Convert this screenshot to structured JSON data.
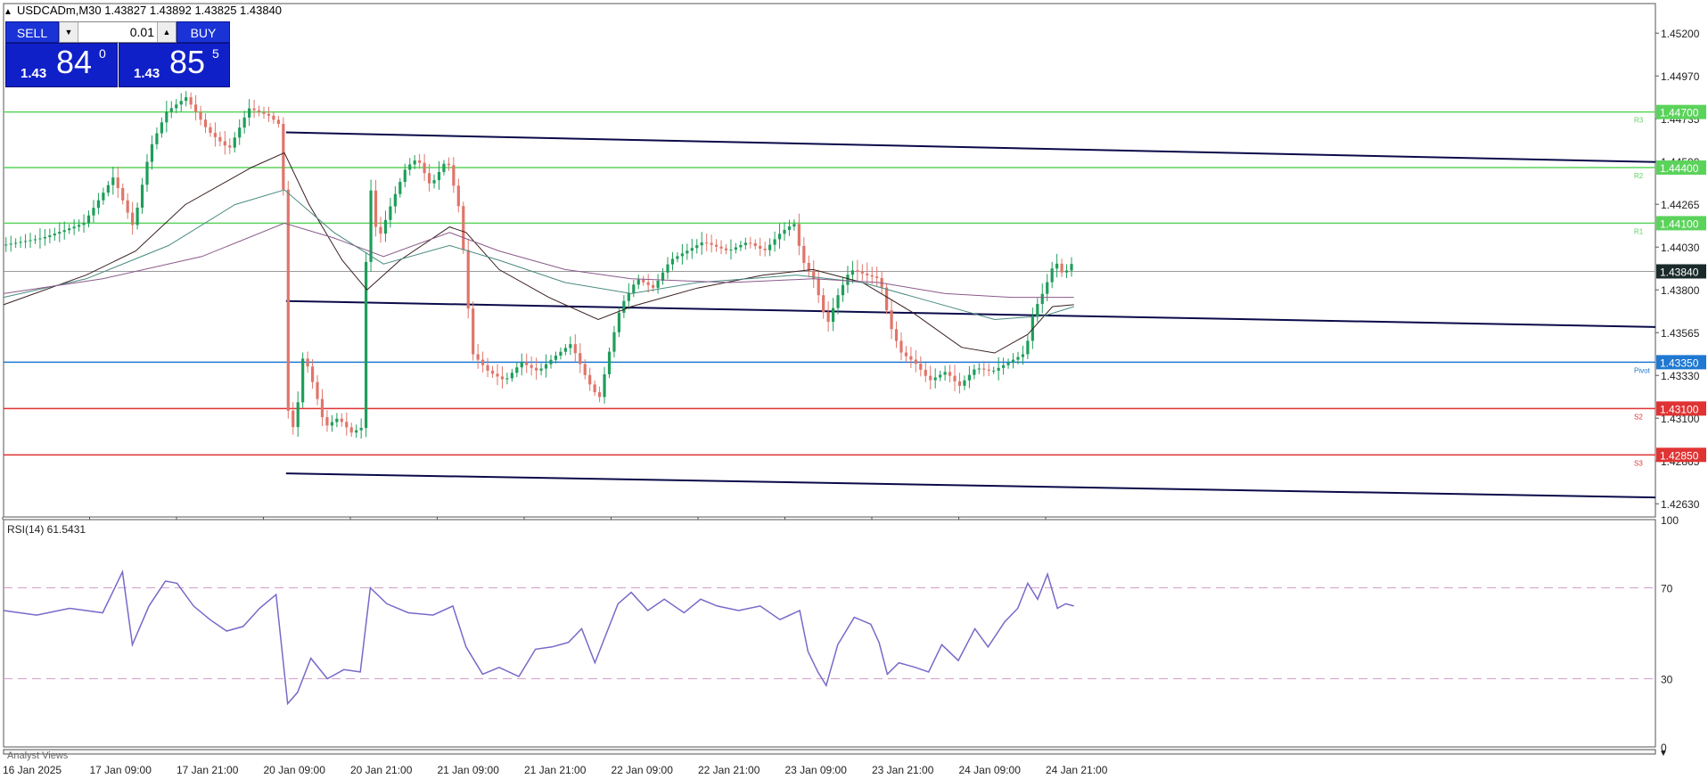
{
  "header": {
    "text": "USDCADm,M30  1.43827 1.43892 1.43825 1.43840"
  },
  "trade": {
    "sell_label": "SELL",
    "buy_label": "BUY",
    "lot": "0.01",
    "bid_small": "1.43",
    "bid_big": "84",
    "bid_sup": "0",
    "ask_small": "1.43",
    "ask_big": "85",
    "ask_sup": "5"
  },
  "rsi_label": "RSI(14) 61.5431",
  "bottom_label": "Analyst Views",
  "colors": {
    "bull": "#1e9e5a",
    "bear": "#e0756a",
    "green_level": "#5bd35b",
    "red_level": "#e03333",
    "pivot": "#1f78d1",
    "rsi": "#7a68c8"
  },
  "chart_data": [
    {
      "type": "candlestick",
      "symbol": "USDCADm",
      "timeframe": "M30",
      "ylim": [
        1.42515,
        1.45285
      ],
      "y_ticks": [
        "1.45200",
        "1.44970",
        "1.44735",
        "1.44500",
        "1.44265",
        "1.44030",
        "1.43800",
        "1.43565",
        "1.43330",
        "1.43100",
        "1.42865",
        "1.42630"
      ],
      "x_tick_labels": [
        "16 Jan 2025",
        "17 Jan 09:00",
        "17 Jan 21:00",
        "20 Jan 09:00",
        "20 Jan 21:00",
        "21 Jan 09:00",
        "21 Jan 21:00",
        "22 Jan 09:00",
        "22 Jan 21:00",
        "23 Jan 09:00",
        "23 Jan 21:00",
        "24 Jan 09:00",
        "24 Jan 21:00"
      ],
      "levels": [
        {
          "label": "R3",
          "value": 1.447,
          "tag": "1.44700",
          "kind": "resistance"
        },
        {
          "label": "R2",
          "value": 1.444,
          "tag": "1.44400",
          "kind": "resistance"
        },
        {
          "label": "R1",
          "value": 1.441,
          "tag": "1.44100",
          "kind": "resistance"
        },
        {
          "label": "Pivot",
          "value": 1.4335,
          "tag": "1.43350",
          "kind": "pivot"
        },
        {
          "label": "S2",
          "value": 1.431,
          "tag": "1.43100",
          "kind": "support"
        },
        {
          "label": "S3",
          "value": 1.4285,
          "tag": "1.42850",
          "kind": "support"
        }
      ],
      "current_price": {
        "value": 1.4384,
        "tag": "1.43840"
      },
      "trendlines": [
        {
          "from": [
            0.171,
            1.4459
          ],
          "to": [
            1.0,
            1.4443
          ]
        },
        {
          "from": [
            0.171,
            1.4368
          ],
          "to": [
            1.0,
            1.4354
          ]
        },
        {
          "from": [
            0.171,
            1.4275
          ],
          "to": [
            1.0,
            1.4262
          ]
        }
      ],
      "price_path": [
        [
          0.0,
          1.4398
        ],
        [
          0.025,
          1.4402
        ],
        [
          0.05,
          1.441
        ],
        [
          0.068,
          1.4435
        ],
        [
          0.08,
          1.4408
        ],
        [
          0.09,
          1.445
        ],
        [
          0.1,
          1.447
        ],
        [
          0.112,
          1.4478
        ],
        [
          0.125,
          1.446
        ],
        [
          0.138,
          1.445
        ],
        [
          0.15,
          1.4472
        ],
        [
          0.162,
          1.4468
        ],
        [
          0.17,
          1.4462
        ],
        [
          0.174,
          1.43
        ],
        [
          0.178,
          1.43
        ],
        [
          0.183,
          1.434
        ],
        [
          0.19,
          1.432
        ],
        [
          0.196,
          1.43
        ],
        [
          0.204,
          1.4305
        ],
        [
          0.212,
          1.4297
        ],
        [
          0.219,
          1.43
        ],
        [
          0.222,
          1.444
        ],
        [
          0.228,
          1.44
        ],
        [
          0.236,
          1.442
        ],
        [
          0.245,
          1.444
        ],
        [
          0.252,
          1.4445
        ],
        [
          0.26,
          1.443
        ],
        [
          0.27,
          1.4445
        ],
        [
          0.278,
          1.4415
        ],
        [
          0.285,
          1.434
        ],
        [
          0.295,
          1.433
        ],
        [
          0.305,
          1.4325
        ],
        [
          0.315,
          1.4335
        ],
        [
          0.325,
          1.433
        ],
        [
          0.335,
          1.4338
        ],
        [
          0.345,
          1.4345
        ],
        [
          0.355,
          1.4325
        ],
        [
          0.362,
          1.4315
        ],
        [
          0.368,
          1.434
        ],
        [
          0.375,
          1.4365
        ],
        [
          0.385,
          1.438
        ],
        [
          0.395,
          1.4375
        ],
        [
          0.405,
          1.439
        ],
        [
          0.415,
          1.4395
        ],
        [
          0.425,
          1.44
        ],
        [
          0.44,
          1.4395
        ],
        [
          0.452,
          1.44
        ],
        [
          0.462,
          1.4395
        ],
        [
          0.472,
          1.4405
        ],
        [
          0.48,
          1.441
        ],
        [
          0.485,
          1.439
        ],
        [
          0.492,
          1.438
        ],
        [
          0.5,
          1.4355
        ],
        [
          0.506,
          1.437
        ],
        [
          0.514,
          1.4385
        ],
        [
          0.524,
          1.4382
        ],
        [
          0.532,
          1.438
        ],
        [
          0.538,
          1.4355
        ],
        [
          0.545,
          1.434
        ],
        [
          0.553,
          1.4335
        ],
        [
          0.562,
          1.4325
        ],
        [
          0.572,
          1.433
        ],
        [
          0.58,
          1.4322
        ],
        [
          0.59,
          1.4332
        ],
        [
          0.6,
          1.433
        ],
        [
          0.61,
          1.4335
        ],
        [
          0.62,
          1.434
        ],
        [
          0.625,
          1.4362
        ],
        [
          0.632,
          1.4375
        ],
        [
          0.638,
          1.439
        ],
        [
          0.643,
          1.4382
        ],
        [
          0.648,
          1.4388
        ]
      ],
      "ma_lines": [
        {
          "name": "MA-dark",
          "color": "#3a2020",
          "points": [
            [
              0.0,
              1.4366
            ],
            [
              0.05,
              1.4382
            ],
            [
              0.08,
              1.4395
            ],
            [
              0.11,
              1.442
            ],
            [
              0.15,
              1.444
            ],
            [
              0.17,
              1.4448
            ],
            [
              0.185,
              1.442
            ],
            [
              0.205,
              1.439
            ],
            [
              0.22,
              1.4374
            ],
            [
              0.24,
              1.439
            ],
            [
              0.27,
              1.4408
            ],
            [
              0.28,
              1.4405
            ],
            [
              0.3,
              1.4385
            ],
            [
              0.33,
              1.437
            ],
            [
              0.36,
              1.4358
            ],
            [
              0.38,
              1.4365
            ],
            [
              0.42,
              1.4375
            ],
            [
              0.46,
              1.4382
            ],
            [
              0.49,
              1.4385
            ],
            [
              0.52,
              1.4378
            ],
            [
              0.55,
              1.4362
            ],
            [
              0.58,
              1.4343
            ],
            [
              0.6,
              1.434
            ],
            [
              0.62,
              1.435
            ],
            [
              0.635,
              1.4365
            ],
            [
              0.648,
              1.4366
            ]
          ]
        },
        {
          "name": "MA-teal",
          "color": "#4a8a80",
          "points": [
            [
              0.0,
              1.437
            ],
            [
              0.05,
              1.438
            ],
            [
              0.1,
              1.4398
            ],
            [
              0.14,
              1.442
            ],
            [
              0.17,
              1.4428
            ],
            [
              0.2,
              1.4405
            ],
            [
              0.23,
              1.4388
            ],
            [
              0.27,
              1.4398
            ],
            [
              0.3,
              1.439
            ],
            [
              0.34,
              1.4378
            ],
            [
              0.38,
              1.4372
            ],
            [
              0.42,
              1.4378
            ],
            [
              0.48,
              1.4382
            ],
            [
              0.52,
              1.4378
            ],
            [
              0.56,
              1.4368
            ],
            [
              0.6,
              1.4358
            ],
            [
              0.63,
              1.436
            ],
            [
              0.648,
              1.4365
            ]
          ]
        },
        {
          "name": "MA-purple",
          "color": "#8a5a8a",
          "points": [
            [
              0.0,
              1.4372
            ],
            [
              0.06,
              1.438
            ],
            [
              0.12,
              1.4392
            ],
            [
              0.17,
              1.441
            ],
            [
              0.2,
              1.4402
            ],
            [
              0.23,
              1.4392
            ],
            [
              0.27,
              1.4405
            ],
            [
              0.3,
              1.4395
            ],
            [
              0.34,
              1.4385
            ],
            [
              0.38,
              1.438
            ],
            [
              0.44,
              1.4378
            ],
            [
              0.49,
              1.438
            ],
            [
              0.53,
              1.4378
            ],
            [
              0.57,
              1.4372
            ],
            [
              0.61,
              1.437
            ],
            [
              0.648,
              1.437
            ]
          ]
        }
      ]
    },
    {
      "type": "line",
      "name": "RSI(14)",
      "value": 61.5431,
      "ylim": [
        0,
        100
      ],
      "y_ticks": [
        100,
        70,
        30,
        0
      ],
      "levels": [
        70,
        30
      ],
      "points": [
        [
          0.0,
          60
        ],
        [
          0.02,
          58
        ],
        [
          0.04,
          61
        ],
        [
          0.06,
          59
        ],
        [
          0.072,
          77
        ],
        [
          0.078,
          45
        ],
        [
          0.088,
          62
        ],
        [
          0.098,
          73
        ],
        [
          0.105,
          72
        ],
        [
          0.115,
          62
        ],
        [
          0.125,
          56
        ],
        [
          0.135,
          51
        ],
        [
          0.145,
          53
        ],
        [
          0.155,
          61
        ],
        [
          0.165,
          67
        ],
        [
          0.172,
          19
        ],
        [
          0.178,
          24
        ],
        [
          0.186,
          39
        ],
        [
          0.196,
          30
        ],
        [
          0.206,
          34
        ],
        [
          0.216,
          33
        ],
        [
          0.222,
          70
        ],
        [
          0.232,
          63
        ],
        [
          0.245,
          59
        ],
        [
          0.26,
          58
        ],
        [
          0.272,
          62
        ],
        [
          0.28,
          44
        ],
        [
          0.29,
          32
        ],
        [
          0.3,
          35
        ],
        [
          0.312,
          31
        ],
        [
          0.322,
          43
        ],
        [
          0.332,
          44
        ],
        [
          0.342,
          46
        ],
        [
          0.35,
          52
        ],
        [
          0.358,
          37
        ],
        [
          0.365,
          50
        ],
        [
          0.372,
          63
        ],
        [
          0.38,
          68
        ],
        [
          0.39,
          60
        ],
        [
          0.4,
          65
        ],
        [
          0.412,
          59
        ],
        [
          0.422,
          65
        ],
        [
          0.432,
          62
        ],
        [
          0.445,
          60
        ],
        [
          0.458,
          62
        ],
        [
          0.47,
          56
        ],
        [
          0.482,
          60
        ],
        [
          0.487,
          42
        ],
        [
          0.493,
          33
        ],
        [
          0.498,
          27
        ],
        [
          0.505,
          45
        ],
        [
          0.515,
          57
        ],
        [
          0.525,
          54
        ],
        [
          0.53,
          46
        ],
        [
          0.535,
          32
        ],
        [
          0.542,
          37
        ],
        [
          0.552,
          35
        ],
        [
          0.56,
          33
        ],
        [
          0.568,
          45
        ],
        [
          0.578,
          38
        ],
        [
          0.588,
          52
        ],
        [
          0.596,
          44
        ],
        [
          0.606,
          55
        ],
        [
          0.614,
          61
        ],
        [
          0.62,
          72
        ],
        [
          0.626,
          65
        ],
        [
          0.632,
          76
        ],
        [
          0.638,
          61
        ],
        [
          0.643,
          63
        ],
        [
          0.648,
          62
        ]
      ]
    }
  ]
}
